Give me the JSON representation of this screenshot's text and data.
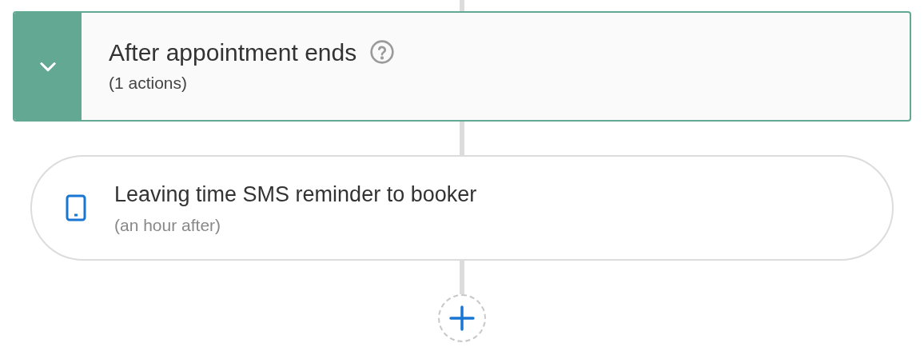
{
  "section": {
    "title": "After appointment ends",
    "subtitle": "(1 actions)",
    "expanded": true
  },
  "actions": [
    {
      "title": "Leaving time SMS reminder to booker",
      "subtitle": "(an hour after)"
    }
  ]
}
